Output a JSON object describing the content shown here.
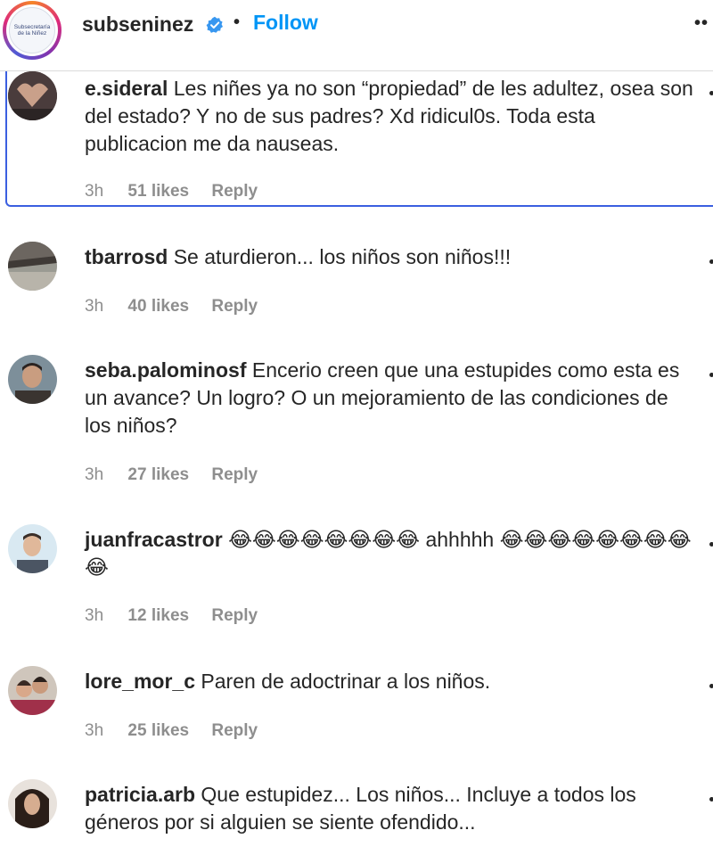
{
  "header": {
    "avatar_text": "Subsecretaría de la Niñez",
    "username": "subseninez",
    "separator": "•",
    "follow_label": "Follow",
    "more_label": "••"
  },
  "comments": [
    {
      "username": "e.sideral",
      "text": "Les niñes ya no son “propiedad” de les adultez, osea son del estado? Y no de sus padres? Xd ridicul0s. Toda esta publicacion me da nauseas.",
      "time": "3h",
      "likes": "51 likes",
      "reply": "Reply",
      "avatar_color": "#5a4a4a"
    },
    {
      "username": "tbarrosd",
      "text": "Se aturdieron... los niños son niños!!!",
      "time": "3h",
      "likes": "40 likes",
      "reply": "Reply",
      "avatar_color": "#8a8a82"
    },
    {
      "username": "seba.palominosf",
      "text": "Encerio creen que una estupides como esta es un avance? Un logro? O un mejoramiento de las condiciones de los niños?",
      "time": "3h",
      "likes": "27 likes",
      "reply": "Reply",
      "avatar_color": "#6b5a4a"
    },
    {
      "username": "juanfracastror",
      "text": "😂😂😂😂😂😂😂😂 ahhhhh 😂😂😂😂😂😂😂😂😂",
      "time": "3h",
      "likes": "12 likes",
      "reply": "Reply",
      "avatar_color": "#cfe3ef"
    },
    {
      "username": "lore_mor_c",
      "text": "Paren de adoctrinar a los niños.",
      "time": "3h",
      "likes": "25 likes",
      "reply": "Reply",
      "avatar_color": "#b09080"
    },
    {
      "username": "patricia.arb",
      "text": "Que estupidez... Los niños... Incluye a todos los géneros por si alguien se siente ofendido...",
      "time": "",
      "likes": "",
      "reply": "",
      "avatar_color": "#7a6658"
    }
  ]
}
